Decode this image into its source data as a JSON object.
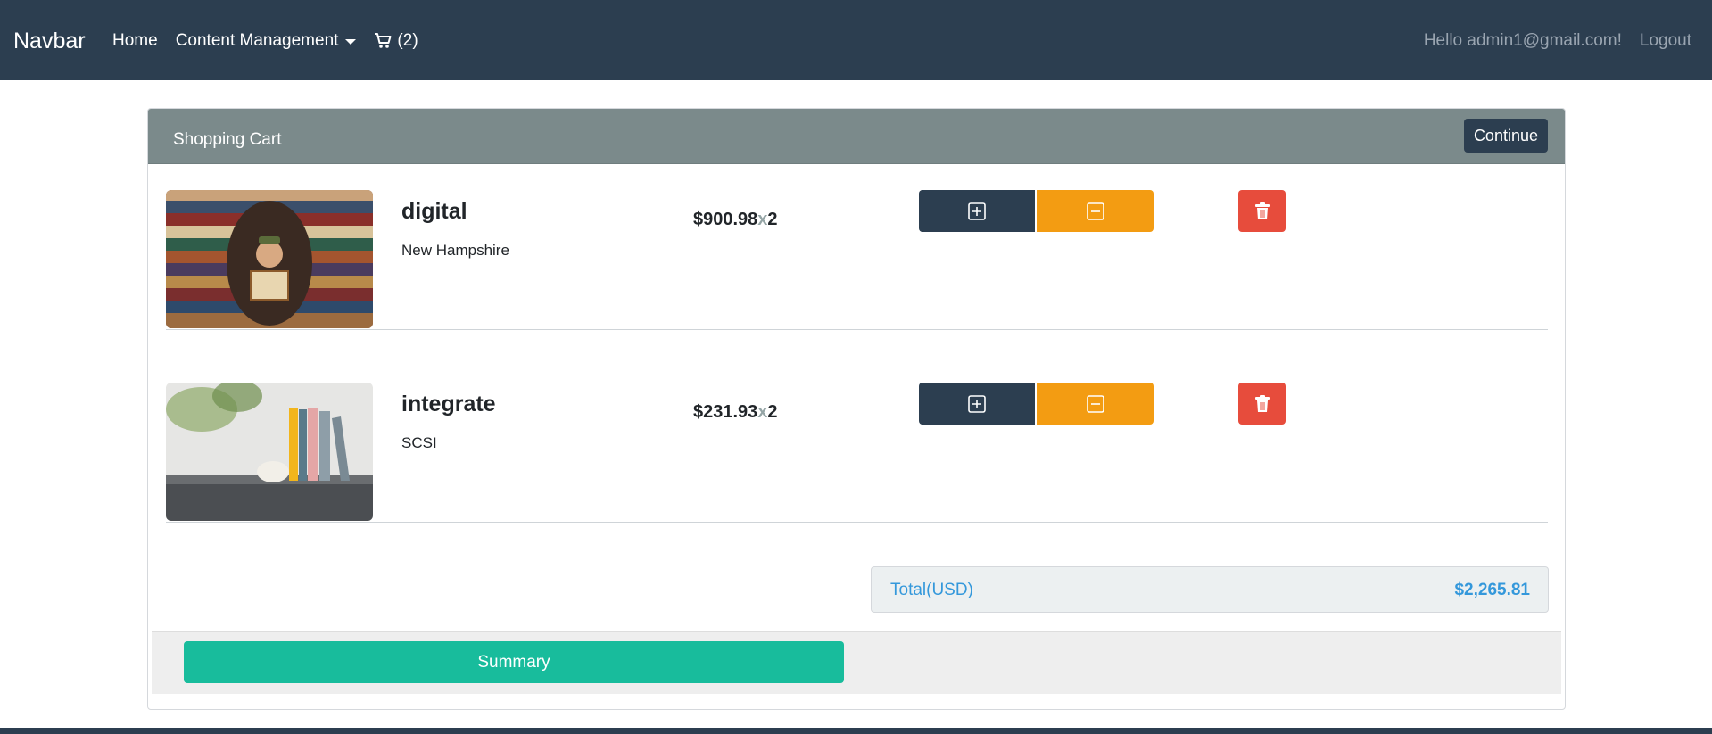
{
  "navbar": {
    "brand": "Navbar",
    "home": "Home",
    "content_management": "Content Management",
    "cart_count": "(2)",
    "greeting": "Hello admin1@gmail.com!",
    "logout": "Logout"
  },
  "cart": {
    "title": "Shopping Cart",
    "continue_label": "Continue",
    "items": [
      {
        "name": "digital",
        "subtitle": "New Hampshire",
        "price": "$900.98",
        "times": "x",
        "qty": "2",
        "image": "bookshelf-reader-photo"
      },
      {
        "name": "integrate",
        "subtitle": "SCSI",
        "price": "$231.93",
        "times": "x",
        "qty": "2",
        "image": "books-on-table-photo"
      }
    ],
    "total_label": "Total(USD)",
    "total_value": "$2,265.81",
    "summary_label": "Summary"
  },
  "colors": {
    "navbar": "#2c3e50",
    "header": "#7b8a8b",
    "plus": "#2c3e50",
    "minus": "#f39c12",
    "delete": "#e74c3c",
    "summary": "#18bc9c",
    "total_text": "#3498db"
  }
}
